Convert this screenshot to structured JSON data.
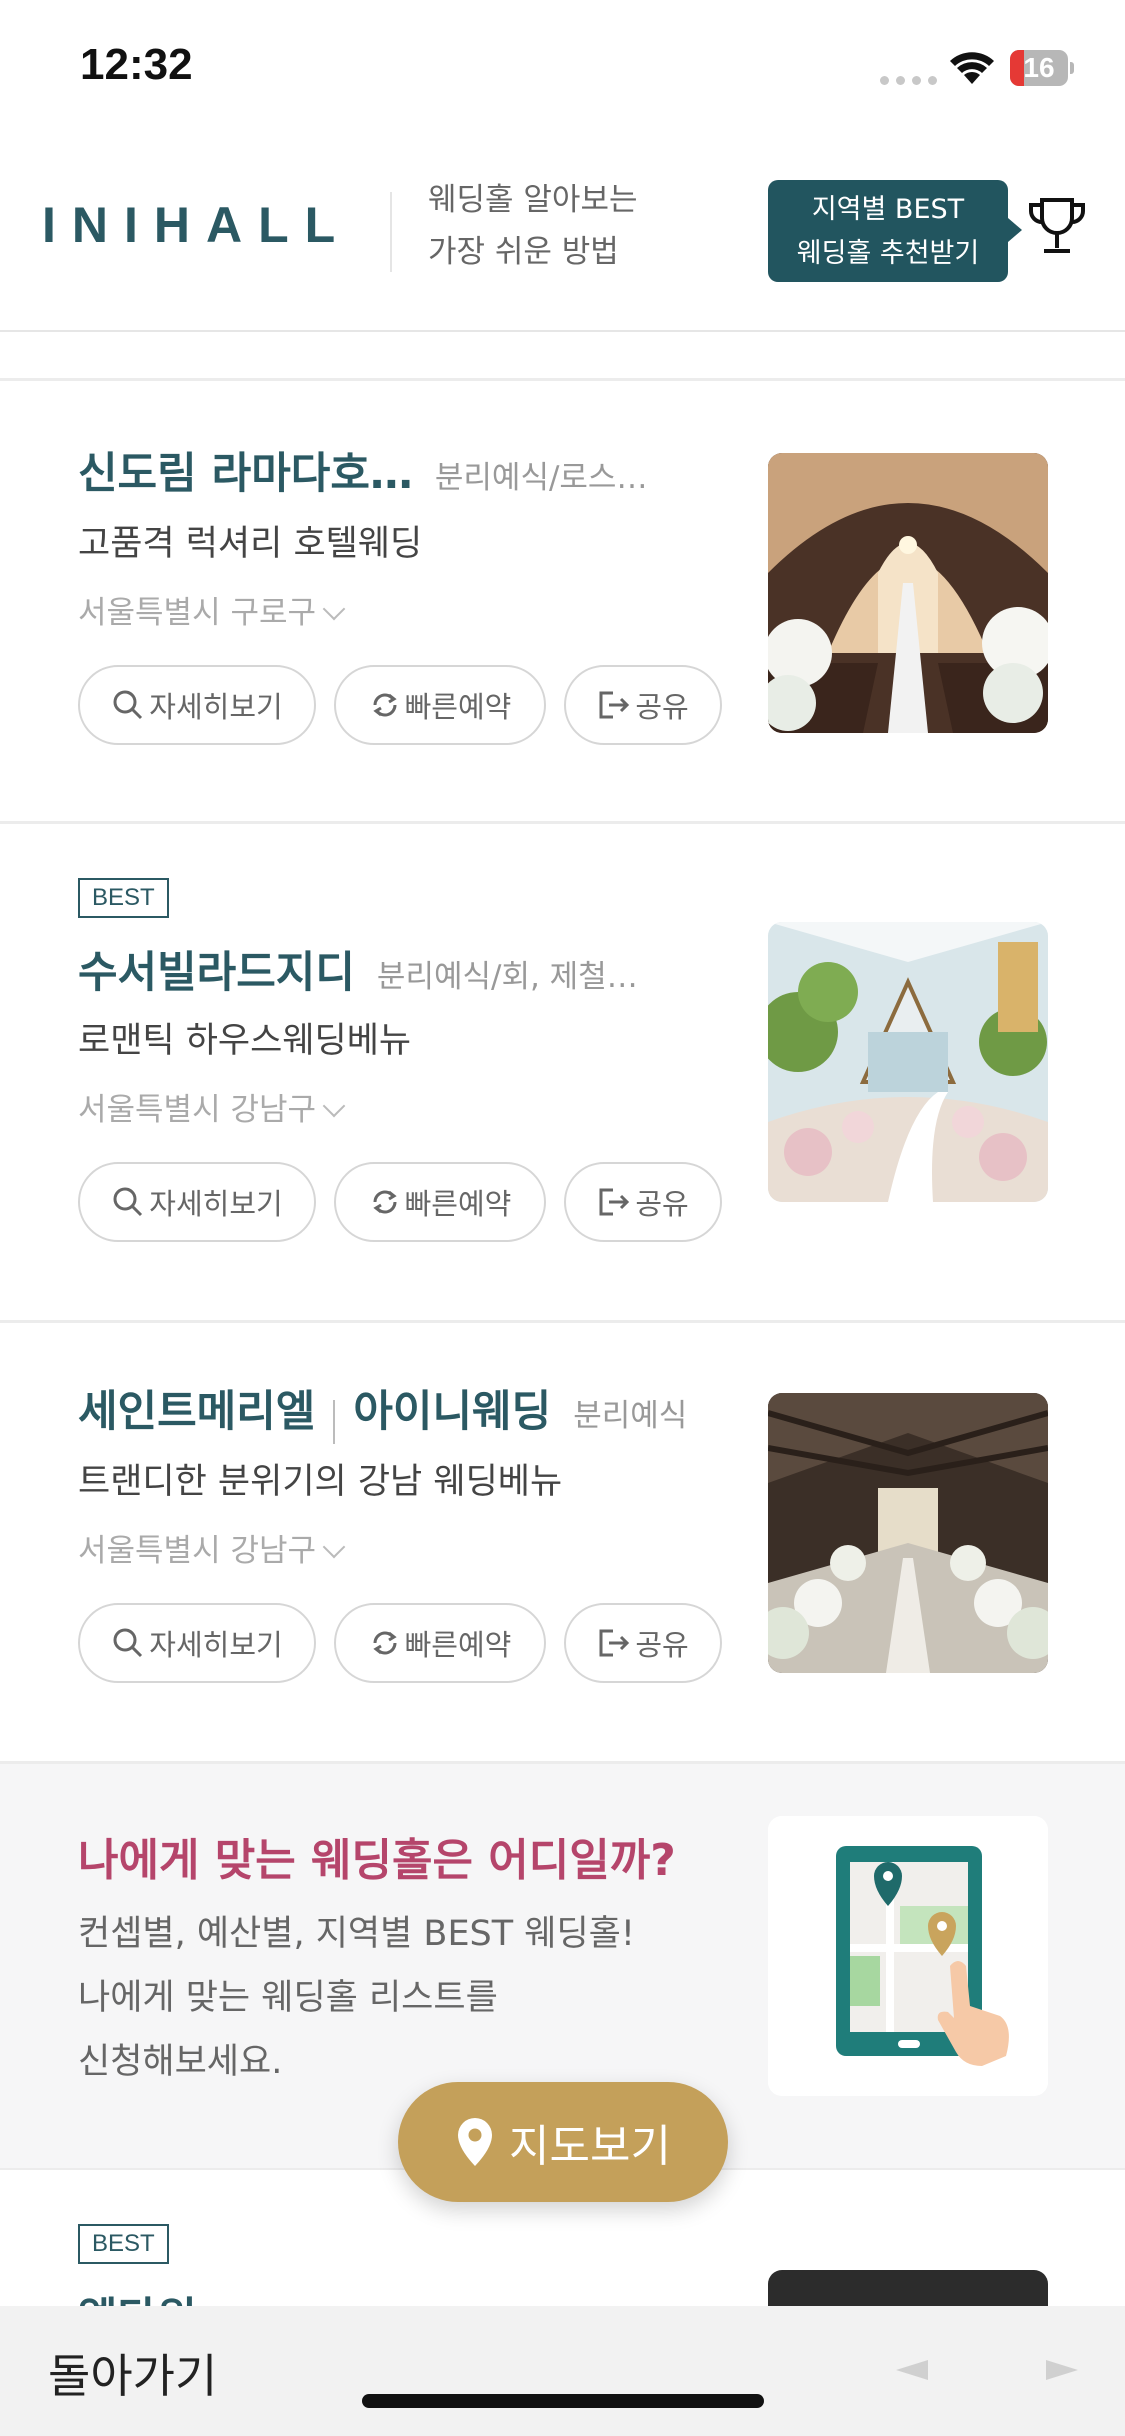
{
  "status": {
    "time": "12:32",
    "battery": "16"
  },
  "header": {
    "logo": "INIHALL",
    "tagline_1": "웨딩홀 알아보는",
    "tagline_2": "가장 쉬운 방법",
    "reco_1": "지역별 BEST",
    "reco_2": "웨딩홀 추천받기",
    "trophy_icon": "trophy-icon"
  },
  "buttons": {
    "detail": "자세히보기",
    "quick": "빠른예약",
    "share": "공유"
  },
  "cards": [
    {
      "badge": "",
      "name": "신도림 라마다호…",
      "category": "분리예식/로스…",
      "subtitle": "고품격 럭셔리 호텔웨딩",
      "region": "서울특별시 구로구"
    },
    {
      "badge": "BEST",
      "name": "수서빌라드지디",
      "category": "분리예식/회, 제철…",
      "subtitle": "로맨틱 하우스웨딩베뉴",
      "region": "서울특별시 강남구"
    },
    {
      "badge": "",
      "name": "세인트메리엘",
      "name2": "아이니웨딩",
      "category": "분리예식",
      "subtitle": "트랜디한 분위기의 강남 웨딩베뉴",
      "region": "서울특별시 강남구"
    }
  ],
  "promo": {
    "title": "나에게 맞는 웨딩홀은 어디일까?",
    "line1": "컨셉별, 예산별, 지역별 BEST 웨딩홀!",
    "line2": "나에게 맞는 웨딩홀 리스트를",
    "line3": "신청해보세요."
  },
  "map_button": "지도보기",
  "card4": {
    "badge": "BEST",
    "name": "엘타워"
  },
  "bottom": {
    "back": "돌아가기"
  },
  "colors": {
    "brand": "#2b5963",
    "gold": "#c4a05a",
    "promo_title": "#b5456b"
  }
}
